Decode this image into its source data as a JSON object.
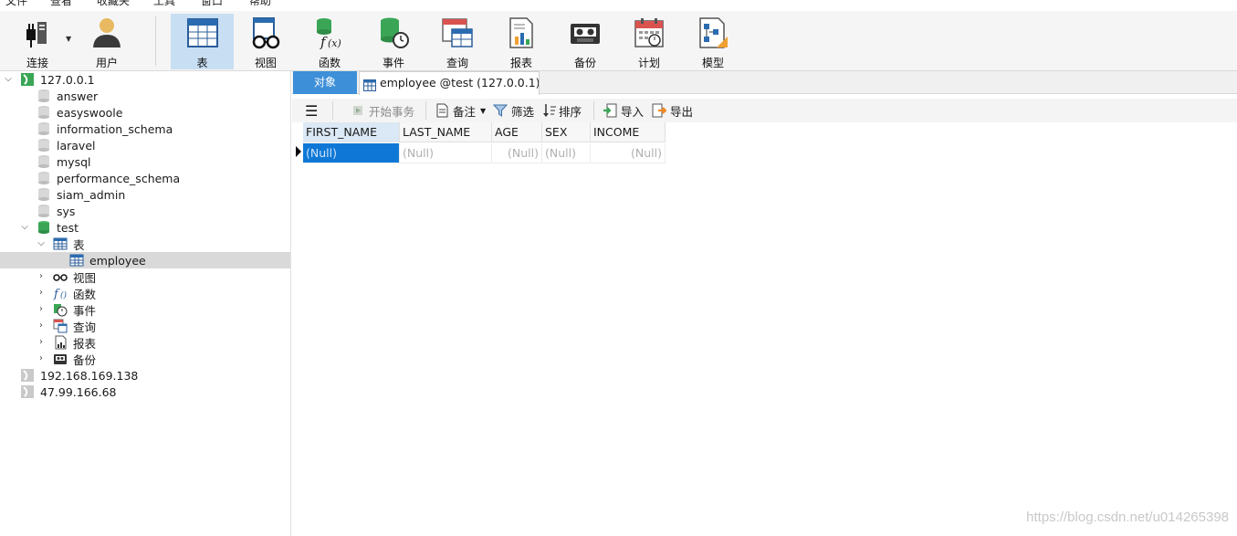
{
  "menu": [
    "文件",
    "查看",
    "收藏夹",
    "工具",
    "窗口",
    "帮助"
  ],
  "toolbar": {
    "connect": "连接",
    "user": "用户",
    "table": "表",
    "view": "视图",
    "function": "函数",
    "event": "事件",
    "query": "查询",
    "report": "报表",
    "backup": "备份",
    "schedule": "计划",
    "model": "模型"
  },
  "tree": {
    "connection1": "127.0.0.1",
    "databases": [
      "answer",
      "easyswoole",
      "information_schema",
      "laravel",
      "mysql",
      "performance_schema",
      "siam_admin",
      "sys"
    ],
    "open_db": "test",
    "tables_group": "表",
    "table_selected": "employee",
    "groups": [
      "视图",
      "函数",
      "事件",
      "查询",
      "报表",
      "备份"
    ],
    "connection2": "192.168.169.138",
    "connection3": "47.99.166.68"
  },
  "tabs": {
    "objects": "对象",
    "editor": "employee @test (127.0.0.1) ..."
  },
  "subtoolbar": {
    "begin_tx": "开始事务",
    "note": "备注",
    "filter": "筛选",
    "sort": "排序",
    "import": "导入",
    "export": "导出"
  },
  "grid": {
    "columns": [
      "FIRST_NAME",
      "LAST_NAME",
      "AGE",
      "SEX",
      "INCOME"
    ],
    "row": [
      "(Null)",
      "(Null)",
      "(Null)",
      "(Null)",
      "(Null)"
    ]
  },
  "watermark": "https://blog.csdn.net/u014265398"
}
